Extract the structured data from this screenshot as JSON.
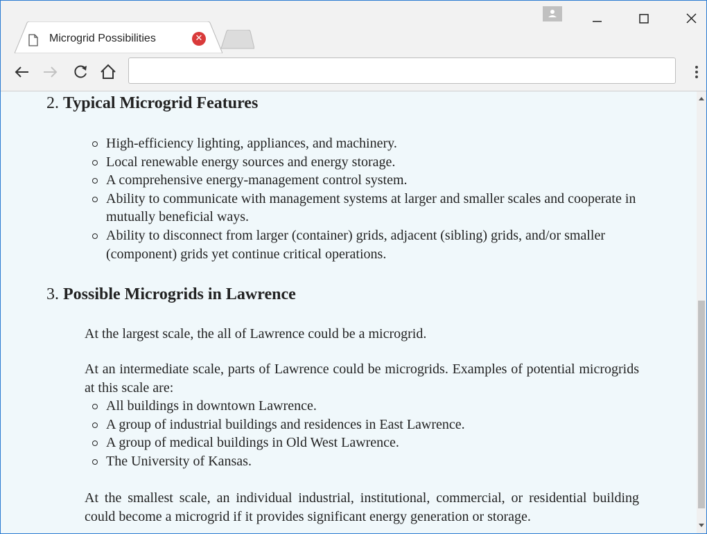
{
  "browser": {
    "tab_title": "Microgrid Possibilities",
    "address_value": "",
    "icons": {
      "tab": "document-icon",
      "close_tab": "close-circle-icon",
      "back": "back-arrow-icon",
      "forward": "forward-arrow-icon",
      "reload": "reload-icon",
      "home": "home-icon",
      "menu": "more-vertical-icon",
      "profile": "profile-icon",
      "minimize": "minimize-icon",
      "maximize": "maximize-icon",
      "close": "close-icon"
    },
    "colors": {
      "window_border": "#2b7bd1",
      "page_background": "#f0f8fb",
      "tab_close": "#d93a3a"
    }
  },
  "page": {
    "section2": {
      "number": "2.",
      "title": "Typical Microgrid Features",
      "items": [
        "High-efficiency lighting, appliances, and machinery.",
        "Local renewable energy sources and energy storage.",
        "A comprehensive energy-management control system.",
        "Ability to communicate with management systems at larger and smaller scales and cooperate in mutually beneficial ways.",
        "Ability to disconnect from larger (container) grids, adjacent (sibling) grids, and/or smaller (component) grids yet continue critical operations."
      ]
    },
    "section3": {
      "number": "3.",
      "title": "Possible Microgrids in Lawrence",
      "para1": "At the largest scale, the all of Lawrence could be a microgrid.",
      "para2": "At an intermediate scale, parts of Lawrence could be microgrids. Examples of potential microgrids at this scale are:",
      "items": [
        "All buildings in downtown Lawrence.",
        "A group of industrial buildings and residences in East Lawrence.",
        "A group of medical buildings in Old West Lawrence.",
        "The University of Kansas."
      ],
      "para3": "At the smallest scale, an individual industrial, institutional, commercial, or residential building could become a microgrid if it provides significant energy generation or storage."
    }
  }
}
